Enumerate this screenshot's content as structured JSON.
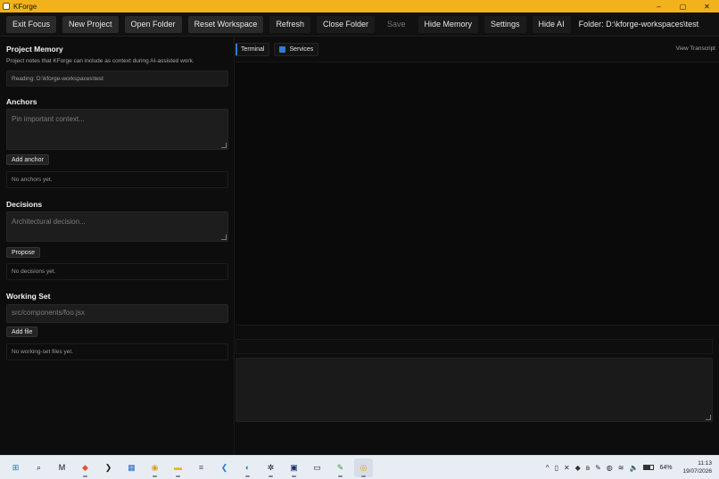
{
  "window": {
    "title": "KForge",
    "controls": [
      "–",
      "▢",
      "✕"
    ]
  },
  "toolbar": {
    "exit_focus": "Exit Focus",
    "new_project": "New Project",
    "open_folder": "Open Folder",
    "reset_workspace": "Reset Workspace",
    "refresh": "Refresh",
    "close_folder": "Close Folder",
    "save": "Save",
    "hide_memory": "Hide Memory",
    "settings": "Settings",
    "hide_ai": "Hide AI",
    "folder": "Folder: D:\\kforge-workspaces\\test"
  },
  "memory": {
    "title": "Project Memory",
    "subtitle": "Project notes that KForge can include as context during AI-assisted work.",
    "reading": "Reading: D:\\kforge-workspaces\\test",
    "anchors": {
      "title": "Anchors",
      "placeholder": "Pin important context...",
      "button": "Add anchor",
      "empty": "No anchors yet."
    },
    "decisions": {
      "title": "Decisions",
      "placeholder": "Architectural decision...",
      "button": "Propose",
      "empty": "No decisions yet."
    },
    "working_set": {
      "title": "Working Set",
      "placeholder": "src/components/foo.jsx",
      "button": "Add file",
      "empty": "No working-set files yet."
    }
  },
  "panel": {
    "tabs": [
      {
        "label": "Terminal",
        "icon": "terminal-icon"
      },
      {
        "label": "Services",
        "icon": "services-icon"
      }
    ],
    "view_transcript": "View Transcript"
  },
  "taskbar": {
    "apps": [
      {
        "name": "start",
        "glyph": "⊞",
        "color": "#1a6fd6"
      },
      {
        "name": "search",
        "glyph": "⌕",
        "color": "#222222"
      },
      {
        "name": "medium",
        "glyph": "M",
        "color": "#111111"
      },
      {
        "name": "brave",
        "glyph": "◆",
        "color": "#e4532a"
      },
      {
        "name": "powershell",
        "glyph": "❯",
        "color": "#1a1a1a"
      },
      {
        "name": "store",
        "glyph": "▦",
        "color": "#2b6cc4"
      },
      {
        "name": "chrome",
        "glyph": "◉",
        "color": "#d8a11a"
      },
      {
        "name": "explorer",
        "glyph": "▬",
        "color": "#e8b62c"
      },
      {
        "name": "notepad",
        "glyph": "≡",
        "color": "#555555"
      },
      {
        "name": "vscode",
        "glyph": "❮",
        "color": "#1f7ad0"
      },
      {
        "name": "edge",
        "glyph": "◐",
        "color": "#1790c9"
      },
      {
        "name": "chatgpt",
        "glyph": "✲",
        "color": "#111111"
      },
      {
        "name": "webstorm",
        "glyph": "▣",
        "color": "#1c2a6b"
      },
      {
        "name": "terminal",
        "glyph": "▭",
        "color": "#222222"
      },
      {
        "name": "paint",
        "glyph": "✎",
        "color": "#3a9a3a"
      },
      {
        "name": "kforge",
        "glyph": "◎",
        "color": "#e0a21a"
      }
    ],
    "tray_icons": [
      "^",
      "▯",
      "✕",
      "◆",
      "ʙ",
      "✎",
      "◍",
      "≋",
      "🔈"
    ],
    "battery": "64%",
    "time": "11:13",
    "date": "19/07/2026"
  },
  "colors": {
    "accent": "#f1b21b",
    "tab_accent": "#2d7ed8"
  }
}
